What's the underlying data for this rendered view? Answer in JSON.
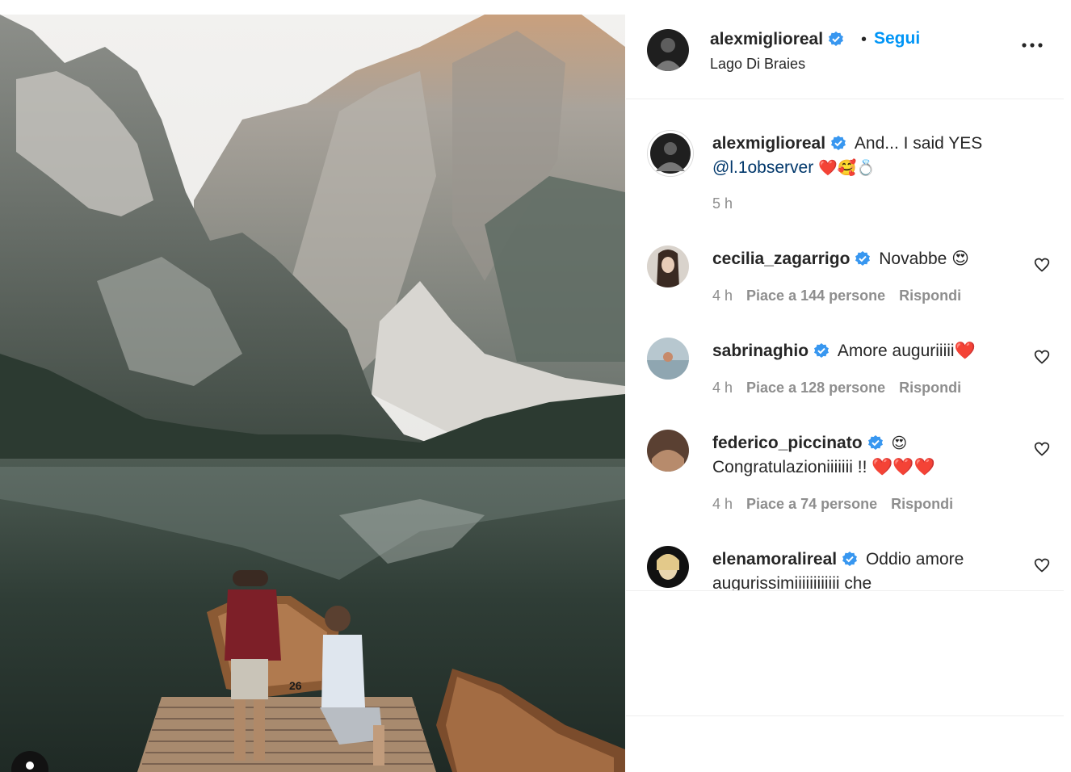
{
  "post": {
    "author": "alexmiglioreal",
    "follow_label": "Segui",
    "dot": "•",
    "location": "Lago Di Braies",
    "more_label": "More options",
    "boat_number": "26"
  },
  "caption": {
    "username": "alexmiglioreal",
    "text": "And... I said YES",
    "mention": "@l.1observer",
    "emojis": "❤️🥰💍",
    "time": "5 h"
  },
  "comments": [
    {
      "username": "cecilia_zagarrigo",
      "text": "Novabbe 😍",
      "time": "4 h",
      "likes": "Piace a 144 persone",
      "reply": "Rispondi"
    },
    {
      "username": "sabrinaghio",
      "text": "Amore auguriiiii❤️",
      "time": "4 h",
      "likes": "Piace a 128 persone",
      "reply": "Rispondi"
    },
    {
      "username": "federico_piccinato",
      "text_line1": "😍",
      "text_line2": "Congratulazioniiiiiii !! ❤️❤️❤️",
      "time": "4 h",
      "likes": "Piace a 74 persone",
      "reply": "Rispondi"
    },
    {
      "username": "elenamoralireal",
      "text_line1": "Oddio amore",
      "text_line2": "augurissimiiiiiiiiiiii che"
    }
  ],
  "colors": {
    "link_blue": "#0095f6",
    "mention_blue": "#00376b",
    "verified_blue": "#3897f0",
    "meta_gray": "#8e8e8e"
  },
  "icons": {
    "verified": "verified-badge-icon",
    "heart": "heart-outline-icon",
    "more": "three-dots-icon",
    "tag": "user-tag-icon"
  }
}
